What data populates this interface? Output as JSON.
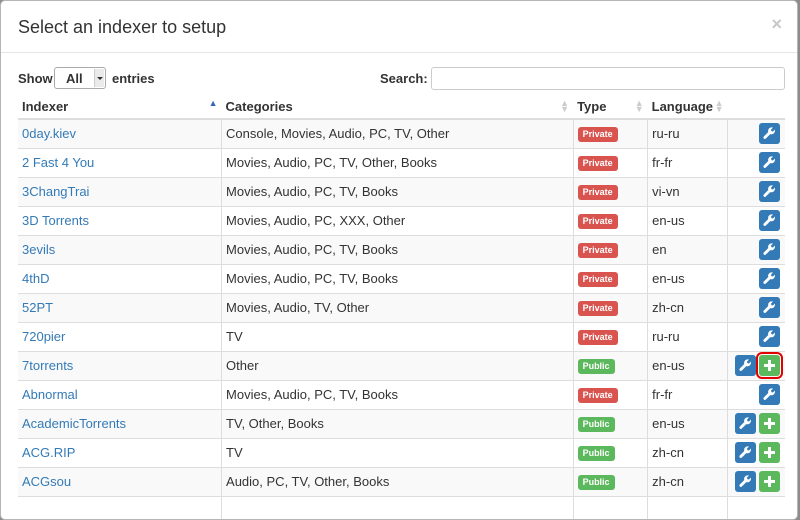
{
  "modal": {
    "title": "Select an indexer to setup",
    "close_label": "×"
  },
  "controls": {
    "show_label": "Show",
    "show_value": "All",
    "entries_label": "entries",
    "search_label": "Search:",
    "search_value": ""
  },
  "table": {
    "headers": [
      "Indexer",
      "Categories",
      "Type",
      "Language",
      ""
    ],
    "sorted_column": "Indexer",
    "sort_direction": "ascending",
    "rows": [
      {
        "name": "0day.kiev",
        "categories": "Console, Movies, Audio, PC, TV, Other",
        "type": "Private",
        "language": "ru-ru",
        "add": false
      },
      {
        "name": "2 Fast 4 You",
        "categories": "Movies, Audio, PC, TV, Other, Books",
        "type": "Private",
        "language": "fr-fr",
        "add": false
      },
      {
        "name": "3ChangTrai",
        "categories": "Movies, Audio, PC, TV, Books",
        "type": "Private",
        "language": "vi-vn",
        "add": false
      },
      {
        "name": "3D Torrents",
        "categories": "Movies, Audio, PC, XXX, Other",
        "type": "Private",
        "language": "en-us",
        "add": false
      },
      {
        "name": "3evils",
        "categories": "Movies, Audio, PC, TV, Books",
        "type": "Private",
        "language": "en",
        "add": false
      },
      {
        "name": "4thD",
        "categories": "Movies, Audio, PC, TV, Books",
        "type": "Private",
        "language": "en-us",
        "add": false
      },
      {
        "name": "52PT",
        "categories": "Movies, Audio, TV, Other",
        "type": "Private",
        "language": "zh-cn",
        "add": false
      },
      {
        "name": "720pier",
        "categories": "TV",
        "type": "Private",
        "language": "ru-ru",
        "add": false
      },
      {
        "name": "7torrents",
        "categories": "Other",
        "type": "Public",
        "language": "en-us",
        "add": true,
        "highlighted": true
      },
      {
        "name": "Abnormal",
        "categories": "Movies, Audio, PC, TV, Books",
        "type": "Private",
        "language": "fr-fr",
        "add": false
      },
      {
        "name": "AcademicTorrents",
        "categories": "TV, Other, Books",
        "type": "Public",
        "language": "en-us",
        "add": true
      },
      {
        "name": "ACG.RIP",
        "categories": "TV",
        "type": "Public",
        "language": "zh-cn",
        "add": true
      },
      {
        "name": "ACGsou",
        "categories": "Audio, PC, TV, Other, Books",
        "type": "Public",
        "language": "zh-cn",
        "add": true
      },
      {
        "name": "",
        "categories": "",
        "type": "",
        "language": "",
        "add": false,
        "partial": true
      }
    ]
  },
  "icons": {
    "configure": "wrench-icon",
    "add": "plus-icon"
  },
  "colors": {
    "link": "#337ab7",
    "private_badge": "#d9534f",
    "public_badge": "#5cb85c",
    "configure_button": "#337ab7",
    "add_button": "#5cb85c",
    "highlight_outline": "#e00000"
  }
}
